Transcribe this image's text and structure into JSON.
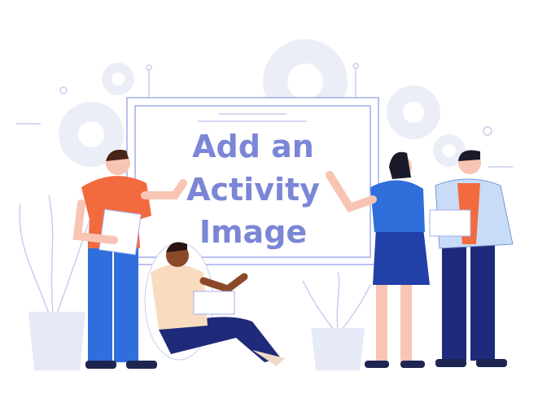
{
  "board": {
    "line1": "Add an",
    "line2": "Activity",
    "line3": "Image"
  },
  "colors": {
    "text": "#7b86d6",
    "board_border": "#a4acec",
    "gear": "#eceef7",
    "orange_shirt": "#f26a3d",
    "blue": "#2f6fdc",
    "navy": "#1f2a7a",
    "skin": "#f8c4b4"
  }
}
